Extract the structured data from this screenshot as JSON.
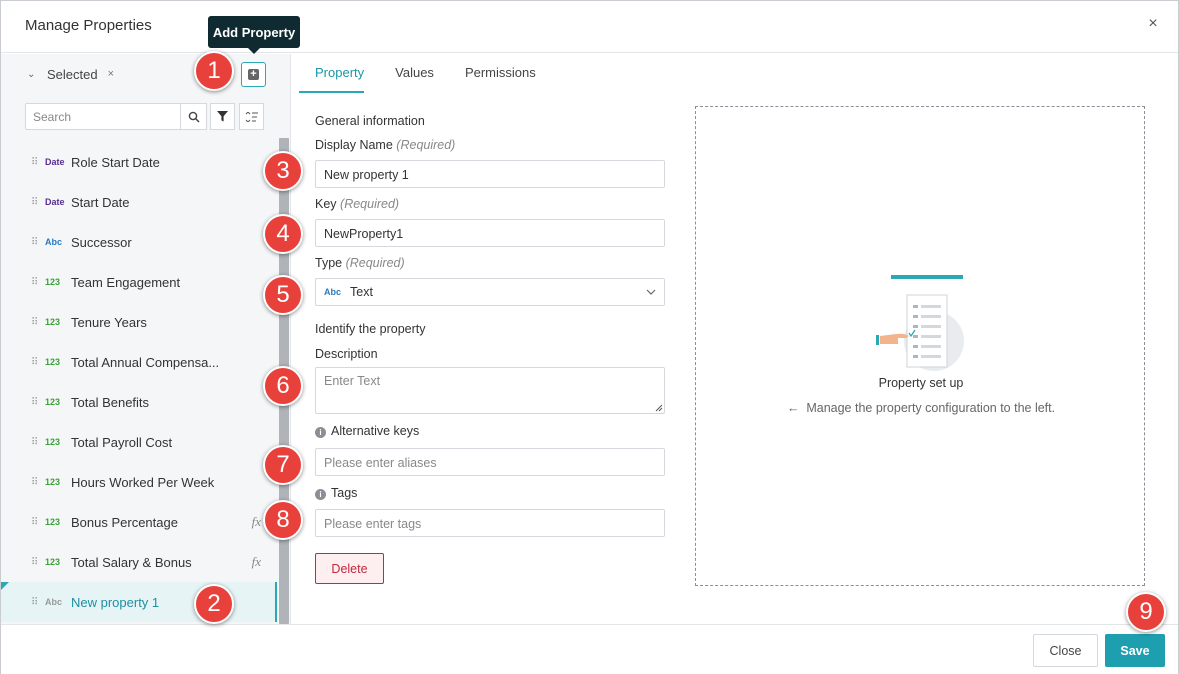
{
  "dialog": {
    "title": "Manage Properties",
    "close_icon": "×"
  },
  "tooltip": {
    "text": "Add Property"
  },
  "sidebar": {
    "filter_label": "Selected",
    "clear_icon": "×",
    "search_placeholder": "Search",
    "items": [
      {
        "type": "Date",
        "label": "Role Start Date",
        "fx": ""
      },
      {
        "type": "Date",
        "label": "Start Date",
        "fx": ""
      },
      {
        "type": "Abc",
        "label": "Successor",
        "fx": ""
      },
      {
        "type": "123",
        "label": "Team Engagement",
        "fx": ""
      },
      {
        "type": "123",
        "label": "Tenure Years",
        "fx": ""
      },
      {
        "type": "123",
        "label": "Total Annual Compensa...",
        "fx": ""
      },
      {
        "type": "123",
        "label": "Total Benefits",
        "fx": ""
      },
      {
        "type": "123",
        "label": "Total Payroll Cost",
        "fx": ""
      },
      {
        "type": "123",
        "label": "Hours Worked Per Week",
        "fx": ""
      },
      {
        "type": "123",
        "label": "Bonus Percentage",
        "fx": "fx"
      },
      {
        "type": "123",
        "label": "Total Salary & Bonus",
        "fx": "fx"
      },
      {
        "type": "Abc",
        "label": "New property 1",
        "fx": ""
      }
    ]
  },
  "tabs": [
    {
      "label": "Property"
    },
    {
      "label": "Values"
    },
    {
      "label": "Permissions"
    }
  ],
  "form": {
    "general_heading": "General information",
    "display_name_label": "Display Name",
    "display_name_req": "(Required)",
    "display_name_value": "New property 1",
    "key_label": "Key",
    "key_req": "(Required)",
    "key_value": "NewProperty1",
    "type_label": "Type",
    "type_req": "(Required)",
    "type_badge": "Abc",
    "type_value": "Text",
    "identify_heading": "Identify the property",
    "description_label": "Description",
    "description_placeholder": "Enter Text",
    "alt_keys_label": "Alternative keys",
    "alt_keys_placeholder": "Please enter aliases",
    "tags_label": "Tags",
    "tags_placeholder": "Please enter tags",
    "delete_label": "Delete"
  },
  "panel": {
    "title": "Property set up",
    "hint": "Manage the property configuration to the left.",
    "arrow": "←"
  },
  "footer": {
    "close_label": "Close",
    "save_label": "Save"
  },
  "annotations": [
    "1",
    "2",
    "3",
    "4",
    "5",
    "6",
    "7",
    "8",
    "9"
  ],
  "colors": {
    "accent": "#1d9fb0",
    "marker": "#e8403a",
    "delete": "#c2293d",
    "date_badge": "#5a2d91",
    "abc_badge": "#2a7abf",
    "num_badge": "#3aa335"
  }
}
